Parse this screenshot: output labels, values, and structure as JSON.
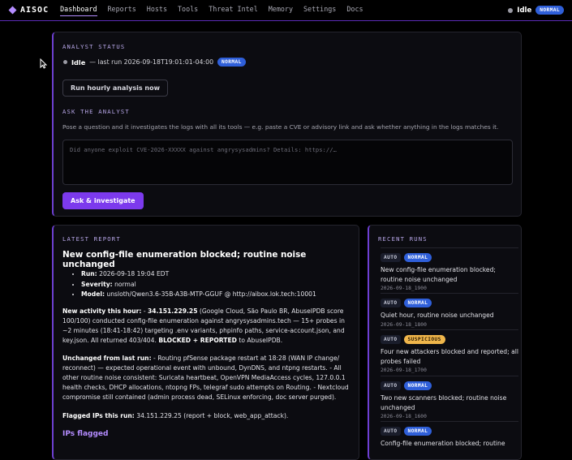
{
  "brand": "AISOC",
  "nav": [
    "Dashboard",
    "Reports",
    "Hosts",
    "Tools",
    "Threat Intel",
    "Memory",
    "Settings",
    "Docs"
  ],
  "top_status": {
    "state": "Idle",
    "badge": "NORMAL"
  },
  "analyst": {
    "label": "ANALYST STATUS",
    "state": "Idle",
    "last_run": "— last run 2026-09-18T19:01:01-04:00",
    "badge": "NORMAL",
    "run_button": "Run hourly analysis now"
  },
  "ask": {
    "label": "ASK THE ANALYST",
    "description": "Pose a question and it investigates the logs with all its tools — e.g. paste a CVE or advisory link and ask whether anything in the logs matches it.",
    "placeholder": "Did anyone exploit CVE-2026-XXXXX against angrysysadmins? Details: https://…",
    "button": "Ask & investigate"
  },
  "report": {
    "label": "LATEST REPORT",
    "title": "New config-file enumeration blocked; routine noise unchanged",
    "meta": [
      {
        "k": "Run:",
        "v": " 2026-09-18 19:04 EDT"
      },
      {
        "k": "Severity:",
        "v": " normal"
      },
      {
        "k": "Model:",
        "v": " unsloth/Qwen3.6-35B-A3B-MTP-GGUF @ http://aibox.lok.tech:10001"
      }
    ],
    "p1_lead": "New activity this hour:",
    "p1_ip": "34.151.229.25",
    "p1_text": " (Google Cloud, São Paulo BR, AbuseIPDB score 100/100) conducted config-file enumeration against angrysysadmins.tech — 15+ probes in ~2 minutes (18:41-18:42) targeting .env variants, phpinfo paths, service-account.json, and key.json. All returned 403/404. ",
    "p1_bold": "BLOCKED + REPORTED",
    "p1_tail": " to AbuseIPDB.",
    "p2_lead": "Unchanged from last run:",
    "p2_text": " - Routing pfSense package restart at 18:28 (WAN IP change/ reconnect) — expected operational event with unbound, DynDNS, and ntpng restarts. - All other routine noise consistent: Suricata heartbeat, OpenVPN MediaAccess cycles, 127.0.0.1 health checks, DHCP allocations, ntopng FPs, telegraf sudo attempts on Routing. - Nextcloud compromise still contained (admin process dead, SELinux enforcing, doc server purged).",
    "p3_lead": "Flagged IPs this run:",
    "p3_text": " 34.151.229.25 (report + block, web_app_attack).",
    "ips_heading": "IPs flagged"
  },
  "recent": {
    "label": "RECENT RUNS",
    "runs": [
      {
        "tag": "AUTO",
        "sev": "NORMAL",
        "title": "New config-file enumeration blocked; routine noise unchanged",
        "time": "2026-09-18_1900"
      },
      {
        "tag": "AUTO",
        "sev": "NORMAL",
        "title": "Quiet hour, routine noise unchanged",
        "time": "2026-09-18_1800"
      },
      {
        "tag": "AUTO",
        "sev": "SUSPICIOUS",
        "title": "Four new attackers blocked and reported; all probes failed",
        "time": "2026-09-18_1700"
      },
      {
        "tag": "AUTO",
        "sev": "NORMAL",
        "title": "Two new scanners blocked; routine noise unchanged",
        "time": "2026-09-18_1600"
      },
      {
        "tag": "AUTO",
        "sev": "NORMAL",
        "title": "Config-file enumeration blocked; routine",
        "time": ""
      }
    ]
  }
}
